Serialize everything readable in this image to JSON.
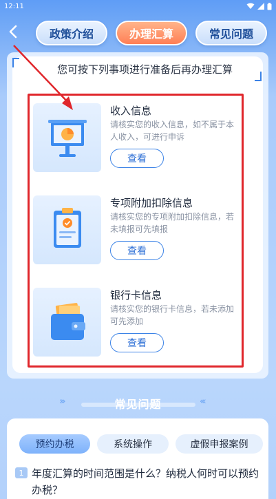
{
  "status_bar": {
    "time": "12:11"
  },
  "nav": {
    "tabs": [
      {
        "label": "政策介绍",
        "active": false
      },
      {
        "label": "办理汇算",
        "active": true
      },
      {
        "label": "常见问题",
        "active": false
      }
    ]
  },
  "intro": "您可按下列事项进行准备后再办理汇算",
  "items": [
    {
      "title": "收入信息",
      "desc": "请核实您的收入信息，如不属于本人收入，可进行申诉",
      "button": "查看",
      "icon": "presentation-chart-icon"
    },
    {
      "title": "专项附加扣除信息",
      "desc": "请核实您的专项附加扣除信息，若未填报可先填报",
      "button": "查看",
      "icon": "clipboard-check-icon"
    },
    {
      "title": "银行卡信息",
      "desc": "请核实您的银行卡信息，若未添加可先添加",
      "button": "查看",
      "icon": "wallet-card-icon"
    }
  ],
  "faq": {
    "heading": "常见问题",
    "tabs": [
      {
        "label": "预约办税",
        "active": true
      },
      {
        "label": "系统操作",
        "active": false
      },
      {
        "label": "虚假申报案例",
        "active": false
      }
    ],
    "questions": [
      {
        "num": "1",
        "text": "年度汇算的时间范围是什么？纳税人何时可以预约办税？"
      }
    ]
  },
  "colors": {
    "accent": "#3a82e6",
    "active_tab": "#ff7f56",
    "annotation": "#e0262b"
  }
}
